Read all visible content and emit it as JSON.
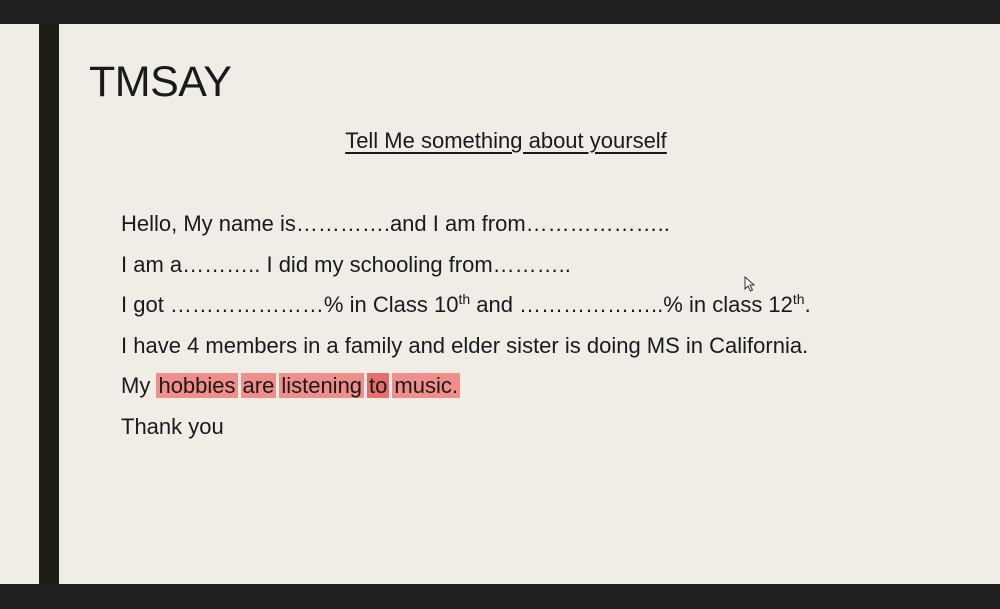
{
  "slide": {
    "title": "TMSAY",
    "subtitle": "Tell Me something about yourself",
    "line1": "Hello, My name is………….and I am from………………..",
    "line2": "I am a……….. I did my schooling from………..",
    "line3": {
      "part1": "I got …………………% in Class 10",
      "sup1": "th",
      "part2": " and ………………..% in class 12",
      "sup2": "th",
      "part3": "."
    },
    "line4": "I have 4 members in a family and elder sister is doing MS in California.",
    "line5": {
      "prefix": "My ",
      "words": [
        "hobbies",
        "are",
        "listening",
        "to",
        "music."
      ]
    },
    "line6": "Thank you"
  },
  "colors": {
    "slide_background": "#efede5",
    "accent_bar": "#1e1e16",
    "highlight": "#f06e6e"
  },
  "icons": [
    "mouse-pointer-icon"
  ]
}
